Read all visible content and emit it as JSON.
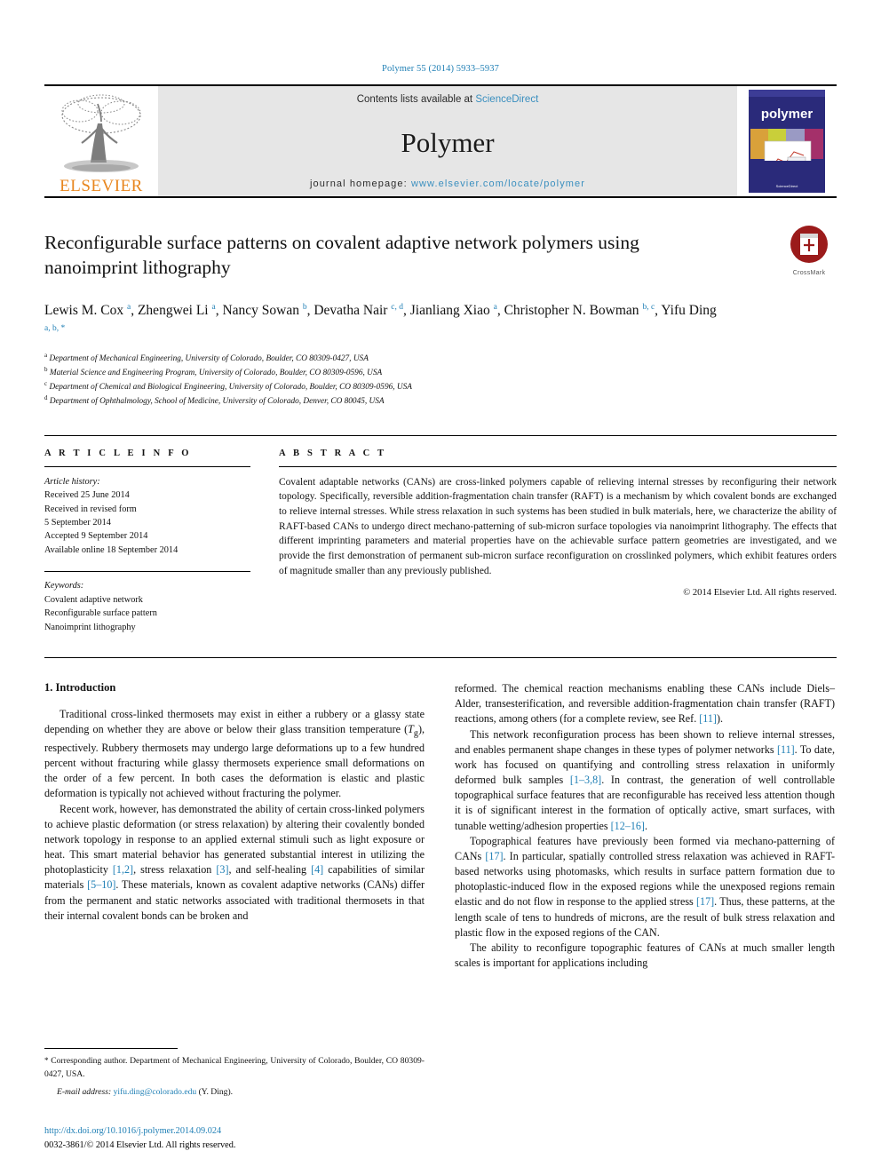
{
  "running_head": "Polymer 55 (2014) 5933–5937",
  "masthead": {
    "publisher": "ELSEVIER",
    "contents_prefix": "Contents lists available at ",
    "contents_link": "ScienceDirect",
    "journal_title": "Polymer",
    "homepage_prefix": "journal homepage: ",
    "homepage_url": "www.elsevier.com/locate/polymer",
    "cover_word": "polymer"
  },
  "crossmark": {
    "label": "CrossMark"
  },
  "title": "Reconfigurable surface patterns on covalent adaptive network polymers using nanoimprint lithography",
  "authors": [
    {
      "name": "Lewis M. Cox",
      "marks": "a"
    },
    {
      "name": "Zhengwei Li",
      "marks": "a"
    },
    {
      "name": "Nancy Sowan",
      "marks": "b"
    },
    {
      "name": "Devatha Nair",
      "marks": "c, d"
    },
    {
      "name": "Jianliang Xiao",
      "marks": "a"
    },
    {
      "name": "Christopher N. Bowman",
      "marks": "b, c"
    },
    {
      "name": "Yifu Ding",
      "marks": "a, b, *"
    }
  ],
  "affiliations": [
    {
      "mark": "a",
      "text": "Department of Mechanical Engineering, University of Colorado, Boulder, CO 80309-0427, USA"
    },
    {
      "mark": "b",
      "text": "Material Science and Engineering Program, University of Colorado, Boulder, CO 80309-0596, USA"
    },
    {
      "mark": "c",
      "text": "Department of Chemical and Biological Engineering, University of Colorado, Boulder, CO 80309-0596, USA"
    },
    {
      "mark": "d",
      "text": "Department of Ophthalmology, School of Medicine, University of Colorado, Denver, CO 80045, USA"
    }
  ],
  "article_info": {
    "heading": "A R T I C L E  I N F O",
    "history_label": "Article history:",
    "history": [
      "Received 25 June 2014",
      "Received in revised form",
      "5 September 2014",
      "Accepted 9 September 2014",
      "Available online 18 September 2014"
    ],
    "keywords_label": "Keywords:",
    "keywords": [
      "Covalent adaptive network",
      "Reconfigurable surface pattern",
      "Nanoimprint lithography"
    ]
  },
  "abstract": {
    "heading": "A B S T R A C T",
    "text": "Covalent adaptable networks (CANs) are cross-linked polymers capable of relieving internal stresses by reconfiguring their network topology. Specifically, reversible addition-fragmentation chain transfer (RAFT) is a mechanism by which covalent bonds are exchanged to relieve internal stresses. While stress relaxation in such systems has been studied in bulk materials, here, we characterize the ability of RAFT-based CANs to undergo direct mechano-patterning of sub-micron surface topologies via nanoimprint lithography. The effects that different imprinting parameters and material properties have on the achievable surface pattern geometries are investigated, and we provide the first demonstration of permanent sub-micron surface reconfiguration on crosslinked polymers, which exhibit features orders of magnitude smaller than any previously published.",
    "copyright": "© 2014 Elsevier Ltd. All rights reserved."
  },
  "introduction": {
    "heading": "1. Introduction",
    "left_paragraphs": [
      "Traditional cross-linked thermosets may exist in either a rubbery or a glassy state depending on whether they are above or below their glass transition temperature (Tg), respectively. Rubbery thermosets may undergo large deformations up to a few hundred percent without fracturing while glassy thermosets experience small deformations on the order of a few percent. In both cases the deformation is elastic and plastic deformation is typically not achieved without fracturing the polymer.",
      "Recent work, however, has demonstrated the ability of certain cross-linked polymers to achieve plastic deformation (or stress relaxation) by altering their covalently bonded network topology in response to an applied external stimuli such as light exposure or heat. This smart material behavior has generated substantial interest in utilizing the photoplasticity [1,2], stress relaxation [3], and self-healing [4] capabilities of similar materials [5–10]. These materials, known as covalent adaptive networks (CANs) differ from the permanent and static networks associated with traditional thermosets in that their internal covalent bonds can be broken and"
    ],
    "right_paragraphs": [
      "reformed. The chemical reaction mechanisms enabling these CANs include Diels–Alder, transesterification, and reversible addition-fragmentation chain transfer (RAFT) reactions, among others (for a complete review, see Ref. [11]).",
      "This network reconfiguration process has been shown to relieve internal stresses, and enables permanent shape changes in these types of polymer networks [11]. To date, work has focused on quantifying and controlling stress relaxation in uniformly deformed bulk samples [1–3,8]. In contrast, the generation of well controllable topographical surface features that are reconfigurable has received less attention though it is of significant interest in the formation of optically active, smart surfaces, with tunable wetting/adhesion properties [12–16].",
      "Topographical features have previously been formed via mechano-patterning of CANs [17]. In particular, spatially controlled stress relaxation was achieved in RAFT-based networks using photomasks, which results in surface pattern formation due to photoplastic-induced flow in the exposed regions while the unexposed regions remain elastic and do not flow in response to the applied stress [17]. Thus, these patterns, at the length scale of tens to hundreds of microns, are the result of bulk stress relaxation and plastic flow in the exposed regions of the CAN.",
      "The ability to reconfigure topographic features of CANs at much smaller length scales is important for applications including"
    ]
  },
  "footnote": {
    "star": "*",
    "text": "Corresponding author. Department of Mechanical Engineering, University of Colorado, Boulder, CO 80309-0427, USA.",
    "email_label": "E-mail address:",
    "email": "yifu.ding@colorado.edu",
    "email_suffix": "(Y. Ding)."
  },
  "footer": {
    "doi": "http://dx.doi.org/10.1016/j.polymer.2014.09.024",
    "issn_line": "0032-3861/© 2014 Elsevier Ltd. All rights reserved."
  },
  "colors": {
    "link": "#1f7fb5",
    "elsevier_orange": "#e8861e",
    "masthead_gray": "#e6e6e6",
    "cover_blue": "#2a2a7a"
  }
}
